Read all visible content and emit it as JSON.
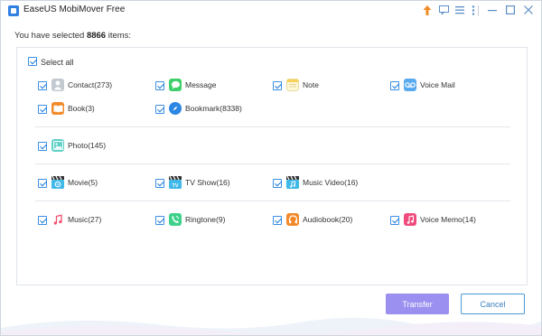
{
  "app": {
    "title": "EaseUS MobiMover Free"
  },
  "titlebar": {
    "icons": [
      "upgrade-arrow-icon",
      "feedback-icon",
      "menu-icon",
      "more-icon",
      "minimize-icon",
      "maximize-icon",
      "close-icon"
    ]
  },
  "summary": {
    "prefix": "You have selected ",
    "count": "8866",
    "suffix": " items:"
  },
  "select_all": {
    "label": "Select all",
    "checked": true
  },
  "rows": [
    [
      {
        "label": "Contact(273)",
        "icon": "contact-icon",
        "color": "#b9c0c8"
      },
      {
        "label": "Message",
        "icon": "message-icon",
        "color": "#3ecf6a"
      },
      {
        "label": "Note",
        "icon": "note-icon",
        "color": "#f6d25c"
      },
      {
        "label": "Voice Mail",
        "icon": "voicemail-icon",
        "color": "#5aaaf0"
      }
    ],
    [
      {
        "label": "Book(3)",
        "icon": "book-icon",
        "color": "#f28a2b"
      },
      {
        "label": "Bookmark(8338)",
        "icon": "bookmark-icon",
        "color": "#2c86e3"
      }
    ],
    [
      {
        "label": "Photo(145)",
        "icon": "photo-icon",
        "color": "#5fd1c7"
      }
    ],
    [
      {
        "label": "Movie(5)",
        "icon": "movie-icon",
        "color": "#40b8e8"
      },
      {
        "label": "TV Show(16)",
        "icon": "tvshow-icon",
        "color": "#40b8e8"
      },
      {
        "label": "Music Video(16)",
        "icon": "music-video-icon",
        "color": "#40b8e8"
      }
    ],
    [
      {
        "label": "Music(27)",
        "icon": "music-icon",
        "color": "#f0506e"
      },
      {
        "label": "Ringtone(9)",
        "icon": "ringtone-icon",
        "color": "#3ed18a"
      },
      {
        "label": "Audiobook(20)",
        "icon": "audiobook-icon",
        "color": "#f28a2b"
      },
      {
        "label": "Voice Memo(14)",
        "icon": "voice-memo-icon",
        "color": "#ef4b7c"
      }
    ]
  ],
  "buttons": {
    "transfer": "Transfer",
    "cancel": "Cancel"
  },
  "colors": {
    "accent": "#3a8ee6",
    "transfer_bg": "#9b8ff0",
    "cancel_border": "#4a9ad6"
  }
}
